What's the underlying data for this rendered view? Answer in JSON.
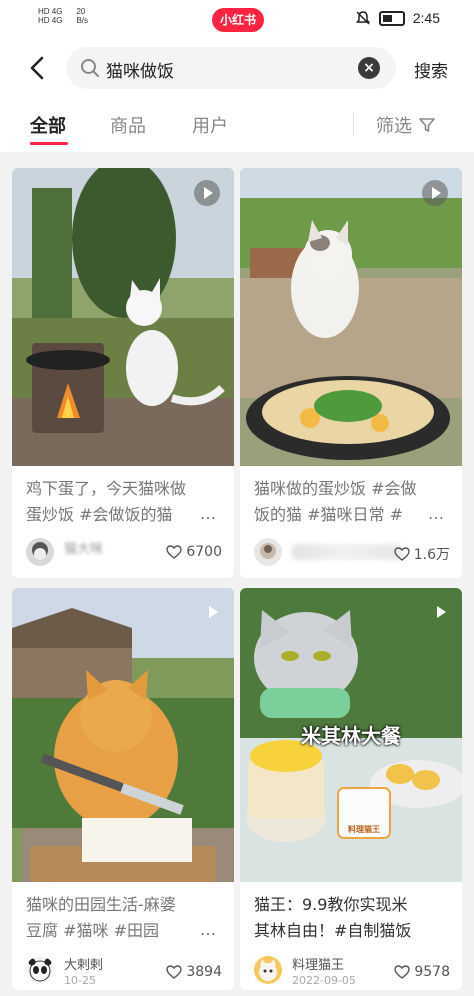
{
  "status_bar": {
    "sim1": "HD 4G",
    "sim2": "HD 4G",
    "speed_value": "20",
    "speed_unit": "B/s",
    "app_badge": "小红书",
    "time": "2:45"
  },
  "header": {
    "search_query": "猫咪做饭",
    "search_button": "搜索"
  },
  "tabs": {
    "items": [
      "全部",
      "商品",
      "用户"
    ],
    "active": "全部",
    "filter_label": "筛选"
  },
  "feed": [
    {
      "title": "鸡下蛋了，今天猫咪做蛋炒饭 #会做饭的猫",
      "title_line1": "鸡下蛋了，今天猫咪做",
      "title_line2": "蛋炒饭 #会做饭的猫",
      "author": "猫大咪",
      "likes": "6700",
      "video": true
    },
    {
      "title": "猫咪做的蛋炒饭 #会做饭的猫 #猫咪日常 #",
      "title_line1": "猫咪做的蛋炒饭 #会做",
      "title_line2": "饭的猫 #猫咪日常 #",
      "author": "",
      "likes": "1.6万",
      "video": true
    },
    {
      "title": "猫咪的田园生活-麻婆豆腐 #猫咪 #田园",
      "title_line1": "猫咪的田园生活-麻婆",
      "title_line2": "豆腐 #猫咪 #田园",
      "author": "大剌剌",
      "date": "10-25",
      "likes": "3894",
      "video": true
    },
    {
      "title": "猫王：9.9教你实现米其林自由！#自制猫饭",
      "title_line1": "猫王：9.9教你实现米",
      "title_line2": "其林自由！#自制猫饭",
      "author": "料理猫王",
      "date": "2022-09-05",
      "likes": "9578",
      "overlay": "米其林大餐",
      "sign_text": "料理猫王",
      "video": true
    }
  ],
  "colors": {
    "accent": "#ff2442",
    "background": "#f2f2f2"
  }
}
